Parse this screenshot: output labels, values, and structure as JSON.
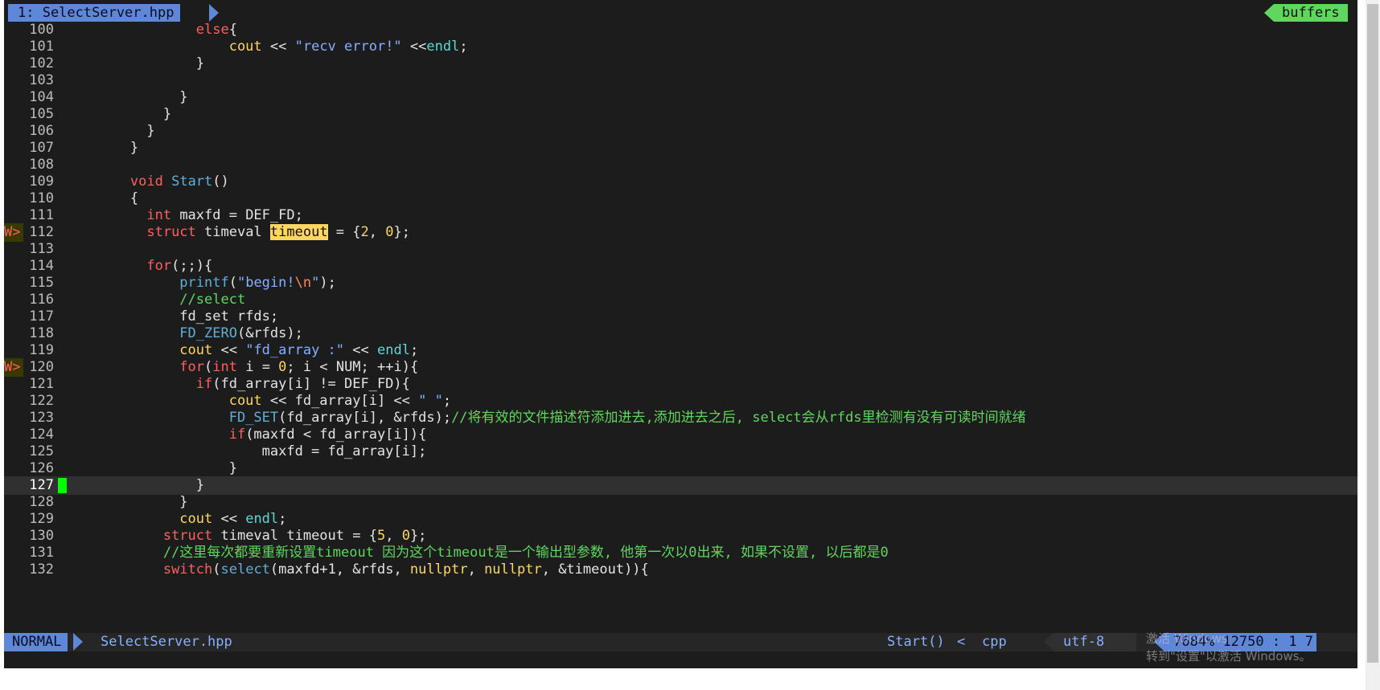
{
  "tabline": {
    "tab_label": "1: SelectServer.hpp",
    "buffers_label": "buffers"
  },
  "editor": {
    "lines": [
      {
        "n": "100",
        "code": "                else{"
      },
      {
        "n": "101",
        "code": "                    cout << \"recv error!\" <<endl;"
      },
      {
        "n": "102",
        "code": "                }"
      },
      {
        "n": "103",
        "code": ""
      },
      {
        "n": "104",
        "code": "              }"
      },
      {
        "n": "105",
        "code": "            }"
      },
      {
        "n": "106",
        "code": "          }"
      },
      {
        "n": "107",
        "code": "        }"
      },
      {
        "n": "108",
        "code": ""
      },
      {
        "n": "109",
        "code": "        void Start()"
      },
      {
        "n": "110",
        "code": "        {"
      },
      {
        "n": "111",
        "code": "          int maxfd = DEF_FD;"
      },
      {
        "n": "112",
        "code": "          struct timeval timeout = {2, 0};",
        "sign": "W>"
      },
      {
        "n": "113",
        "code": ""
      },
      {
        "n": "114",
        "code": "          for(;;){"
      },
      {
        "n": "115",
        "code": "              printf(\"begin!\\n\");"
      },
      {
        "n": "116",
        "code": "              //select"
      },
      {
        "n": "117",
        "code": "              fd_set rfds;"
      },
      {
        "n": "118",
        "code": "              FD_ZERO(&rfds);"
      },
      {
        "n": "119",
        "code": "              cout << \"fd_array :\" << endl;"
      },
      {
        "n": "120",
        "code": "              for(int i = 0; i < NUM; ++i){",
        "sign": "W>"
      },
      {
        "n": "121",
        "code": "                if(fd_array[i] != DEF_FD){"
      },
      {
        "n": "122",
        "code": "                    cout << fd_array[i] << \" \";"
      },
      {
        "n": "123",
        "code": "                    FD_SET(fd_array[i], &rfds);//将有效的文件描述符添加进去,添加进去之后, select会从rfds里检测有没有可读时间就绪"
      },
      {
        "n": "124",
        "code": "                    if(maxfd < fd_array[i]){"
      },
      {
        "n": "125",
        "code": "                        maxfd = fd_array[i];"
      },
      {
        "n": "126",
        "code": "                    }"
      },
      {
        "n": "127",
        "code": "                }",
        "current": true
      },
      {
        "n": "128",
        "code": "              }"
      },
      {
        "n": "129",
        "code": "              cout << endl;"
      },
      {
        "n": "130",
        "code": "            struct timeval timeout = {5, 0};"
      },
      {
        "n": "131",
        "code": "            //这里每次都要重新设置timeout 因为这个timeout是一个输出型参数, 他第一次以0出来, 如果不设置, 以后都是0"
      },
      {
        "n": "132",
        "code": "            switch(select(maxfd+1, &rfds, nullptr, nullptr, &timeout)){"
      }
    ]
  },
  "statusline": {
    "mode": "NORMAL",
    "filename": "SelectServer.hpp",
    "function": "Start()",
    "chevron": "<",
    "filetype": "cpp",
    "encoding": "utf-8",
    "percent": "7684%",
    "position": "12750 :  1 7"
  },
  "watermark": {
    "line1": "激活 Windows",
    "line2": "转到\"设置\"以激活 Windows。"
  },
  "colors": {
    "background": "#1c1c1c",
    "accent_blue": "#5f87d7",
    "accent_green": "#5fd75f",
    "keyword_red": "#ff5f5f",
    "string_blue": "#87afff"
  }
}
